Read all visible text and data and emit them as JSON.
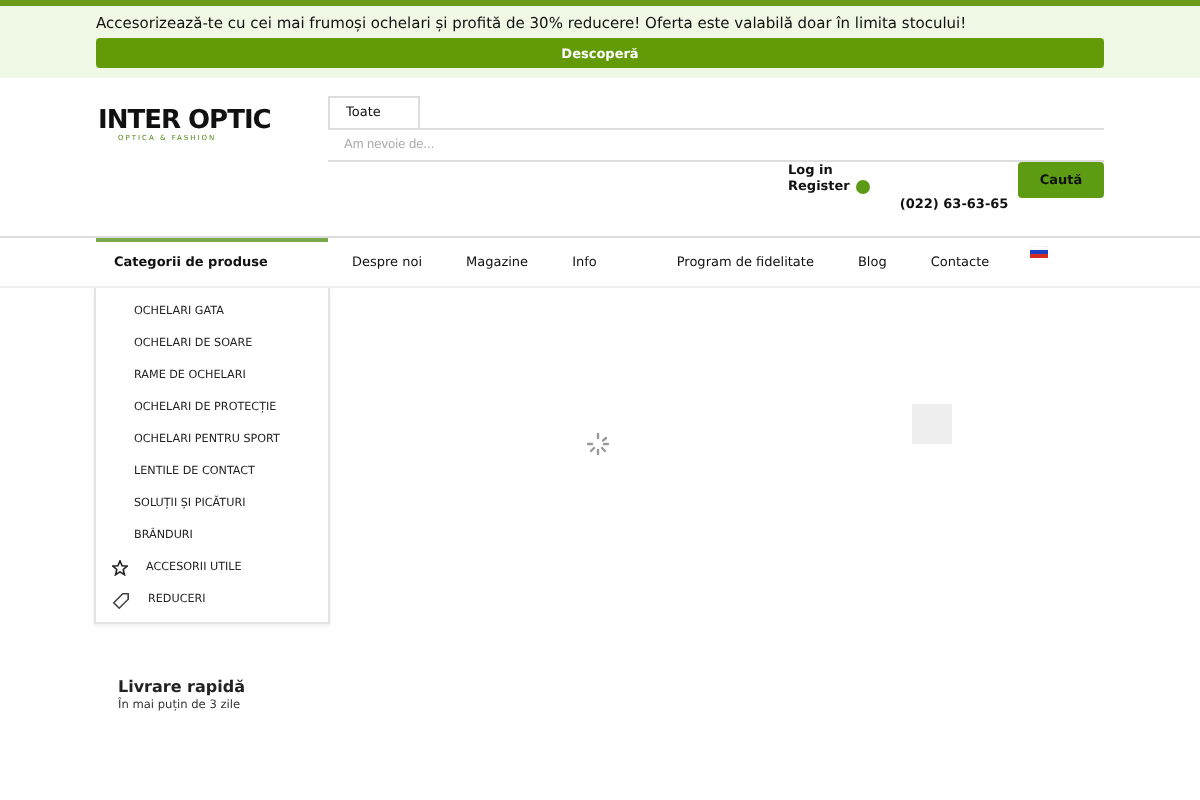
{
  "promo": {
    "text": "Accesorizează-te cu cei mai frumoși ochelari și profită de 30% reducere! Oferta este valabilă doar în limita stocului!",
    "button": "Descoperă"
  },
  "header": {
    "logo": "INTER OPTIC",
    "logo_tagline": "OPTICA & FASHION",
    "category_select": "Toate",
    "search_placeholder": "Am nevoie de...",
    "login": "Log in",
    "register": "Register",
    "phone": "(022) 63-63-65",
    "search_button": "Caută"
  },
  "nav": {
    "categories_title": "Categorii de produse",
    "links": [
      {
        "label": "Despre noi"
      },
      {
        "label": "Magazine"
      },
      {
        "label": "Info"
      },
      {
        "label": "Program de fidelitate"
      },
      {
        "label": "Blog"
      },
      {
        "label": "Contacte"
      }
    ]
  },
  "categories": [
    {
      "label": "OCHELARI GATA",
      "kind": "plain"
    },
    {
      "label": "OCHELARI DE SOARE",
      "kind": "plain"
    },
    {
      "label": "RAME DE OCHELARI",
      "kind": "plain"
    },
    {
      "label": "OCHELARI DE PROTECȚIE",
      "kind": "plain"
    },
    {
      "label": "OCHELARI PENTRU SPORT",
      "kind": "plain"
    },
    {
      "label": "LENTILE DE CONTACT",
      "kind": "plain"
    },
    {
      "label": "SOLUȚII ȘI PICĂTURI",
      "kind": "plain"
    },
    {
      "label": "BRÂNDURI",
      "kind": "plain"
    },
    {
      "label": "ACCESORII UTILE",
      "kind": "star"
    },
    {
      "label": "REDUCERI",
      "kind": "tag"
    }
  ],
  "feature": {
    "title": "Livrare rapidă",
    "subtitle": "În mai puțin de 3 zile"
  }
}
